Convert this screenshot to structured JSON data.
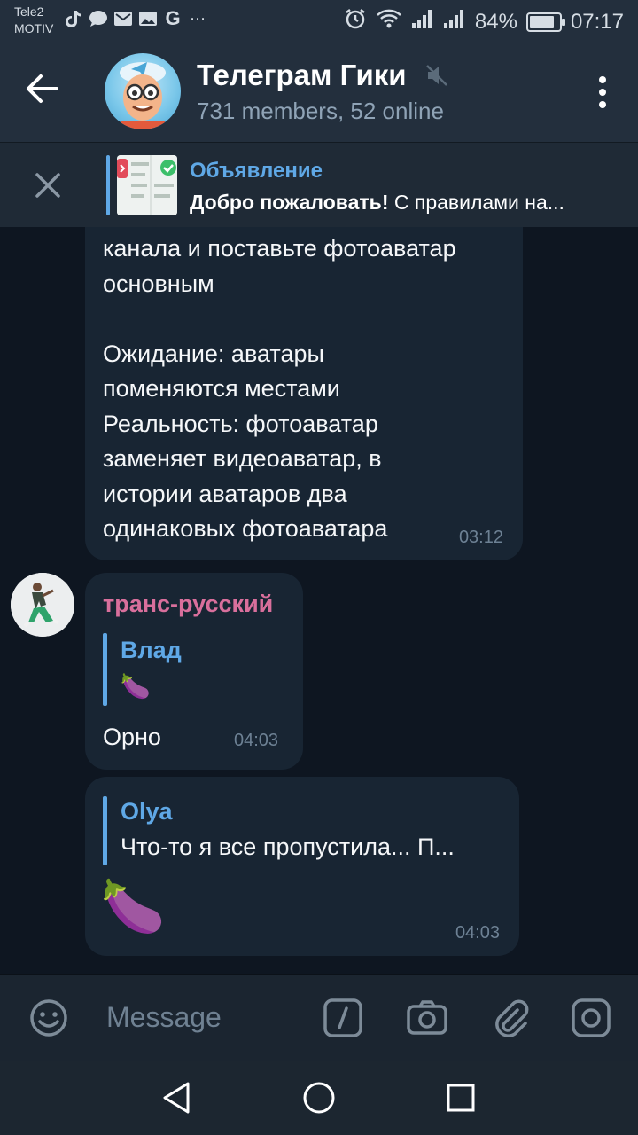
{
  "status_bar": {
    "carrier_line1": "Tele2",
    "carrier_line2": "MOTIV",
    "battery_percent": "84%",
    "battery_level": 0.84,
    "time": "07:17",
    "left_icons": [
      "tiktok-icon",
      "chat-bubble-icon",
      "mail-icon",
      "gallery-icon",
      "google-icon",
      "more-dots-icon"
    ],
    "right_icons": [
      "alarm-icon",
      "wifi-icon",
      "signal-icon",
      "signal-icon"
    ]
  },
  "header": {
    "title": "Телеграм Гики",
    "subtitle": "731 members, 52 online",
    "muted": true
  },
  "pinned": {
    "title": "Объявление",
    "text_bold": "Добро пожаловать!",
    "text_rest": " С правилами на..."
  },
  "messages": [
    {
      "text": "канала и поставьте фотоаватар\nосновным\n\nОжидание: аватары\nпоменяются местами\nРеальность: фотоаватар\nзаменяет видеоаватар, в\nистории аватаров два\nодинаковых фотоаватара",
      "time": "03:12"
    },
    {
      "sender": "транс-русский",
      "reply_name": "Влад",
      "reply_text": "🍆",
      "text": "Орно",
      "time": "04:03"
    },
    {
      "reply_name": "Olya",
      "reply_text": "Что-то я все пропустила... П...",
      "text": "🍆",
      "time": "04:03"
    }
  ],
  "input": {
    "placeholder": "Message"
  },
  "colors": {
    "accent": "#5fa8e6",
    "sender_name": "#d96f9c",
    "background": "#0e1621",
    "bubble": "#182533"
  }
}
